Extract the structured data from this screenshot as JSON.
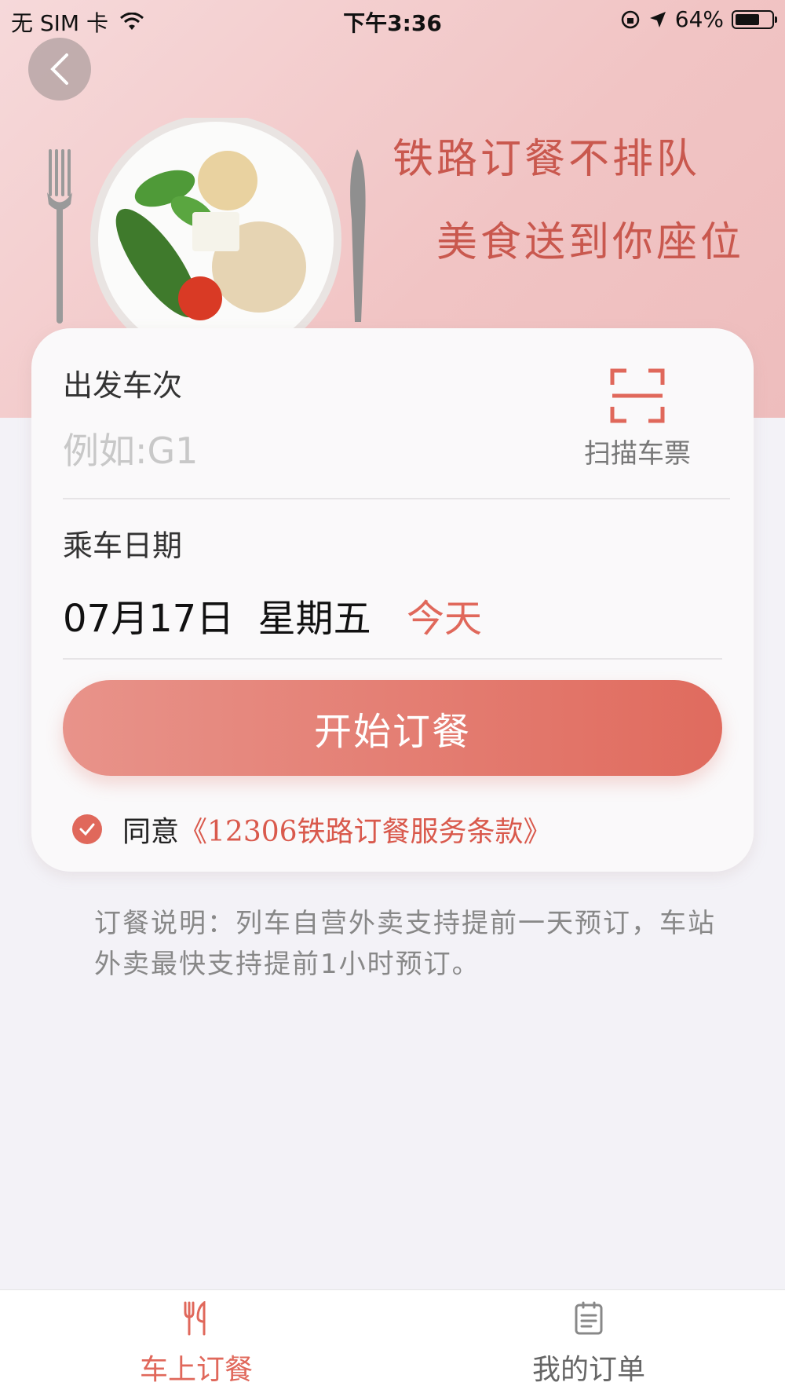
{
  "status_bar": {
    "carrier": "无 SIM 卡",
    "time": "下午3:36",
    "battery": "64%"
  },
  "banner": {
    "slogan_line1": "铁路订餐不排队",
    "slogan_line2": "美食送到你座位"
  },
  "form": {
    "train_label": "出发车次",
    "train_placeholder": "例如:G1",
    "scan_label": "扫描车票",
    "date_label": "乘车日期",
    "date_value": "07月17日  星期五",
    "date_tag": "今天",
    "start_button": "开始订餐",
    "agree_text": "同意",
    "terms_link": "《12306铁路订餐服务条款》"
  },
  "notice": "订餐说明：列车自营外卖支持提前一天预订，车站外卖最快支持提前1小时预订。",
  "tabs": [
    {
      "label": "车上订餐",
      "icon": "fork-knife-icon",
      "active": true
    },
    {
      "label": "我的订单",
      "icon": "order-list-icon",
      "active": false
    }
  ],
  "colors": {
    "accent": "#e0685b",
    "slogan": "#c9584e",
    "background": "#f3f2f7"
  }
}
